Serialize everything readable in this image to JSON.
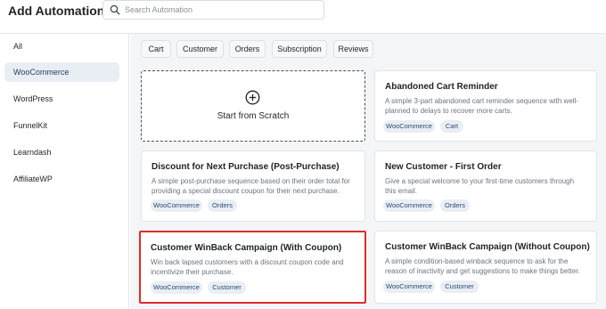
{
  "header": {
    "title": "Add Automation",
    "search_placeholder": "Search Automation"
  },
  "sidebar": {
    "items": [
      {
        "label": "All",
        "active": false
      },
      {
        "label": "WooCommerce",
        "active": true
      },
      {
        "label": "WordPress",
        "active": false
      },
      {
        "label": "FunnelKit",
        "active": false
      },
      {
        "label": "Learndash",
        "active": false
      },
      {
        "label": "AffiliateWP",
        "active": false
      }
    ]
  },
  "filters": [
    "Cart",
    "Customer",
    "Orders",
    "Subscription",
    "Reviews"
  ],
  "scratch": {
    "label": "Start from Scratch"
  },
  "cards": [
    {
      "title": "Abandoned Cart Reminder",
      "desc": "A simple 3-part abandoned cart reminder sequence with well-planned to delays to recover more carts.",
      "tags": [
        "WooCommerce",
        "Cart"
      ]
    },
    {
      "title": "Discount for Next Purchase (Post-Purchase)",
      "desc": "A simple post-purchase sequence based on their order total for providing a special discount coupon for their next purchase.",
      "tags": [
        "WooCommerce",
        "Orders"
      ]
    },
    {
      "title": "New Customer - First Order",
      "desc": "Give a special welcome to your first-time customers through this email.",
      "tags": [
        "WooCommerce",
        "Orders"
      ]
    },
    {
      "title": "Customer WinBack Campaign (With Coupon)",
      "desc": "Win back lapsed customers with a discount coupon code and incentivize their purchase.",
      "tags": [
        "WooCommerce",
        "Customer"
      ],
      "highlighted": true
    },
    {
      "title": "Customer WinBack Campaign (Without Coupon)",
      "desc": "A simple condition-based winback sequence to ask for the reason of inactivity and get suggestions to make things better.",
      "tags": [
        "WooCommerce",
        "Customer"
      ]
    }
  ],
  "colors": {
    "highlight_border": "#e02b2b",
    "active_sidebar_bg": "#e9eef4",
    "tag_bg": "#e9eef4",
    "main_bg": "#f4f5f7"
  }
}
